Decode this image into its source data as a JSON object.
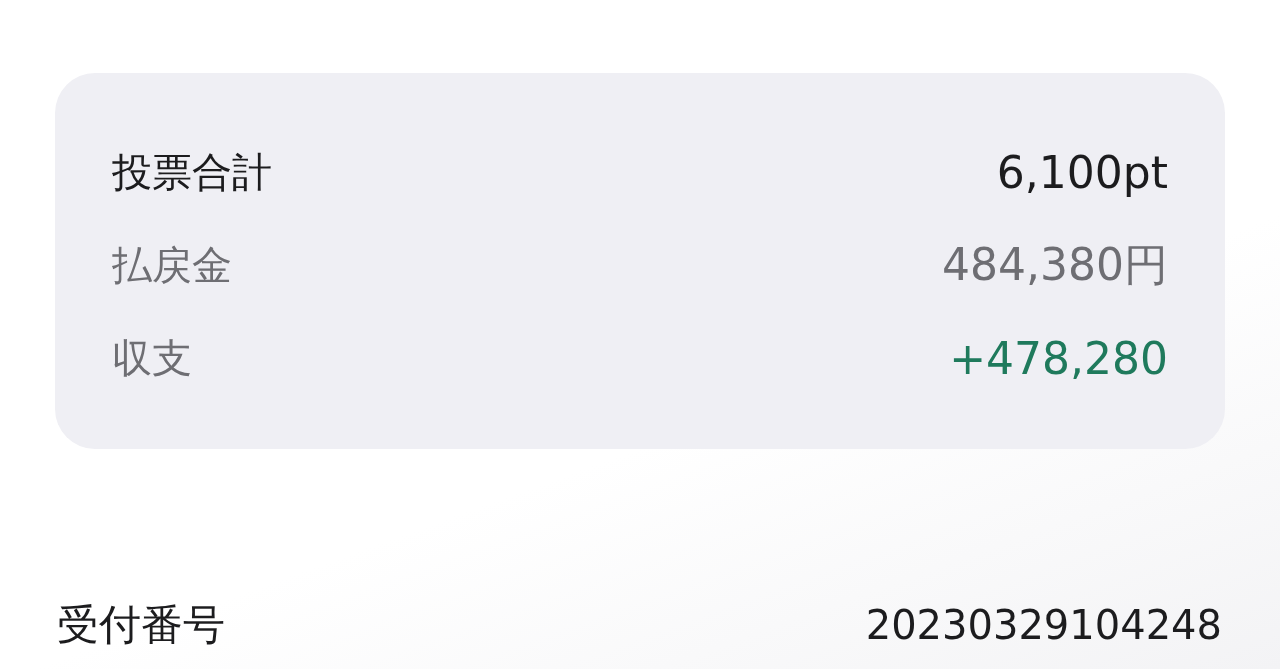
{
  "summary": {
    "rows": [
      {
        "label": "投票合計",
        "value": "6,100pt",
        "kind": "primary"
      },
      {
        "label": "払戻金",
        "value": "484,380円",
        "kind": "secondary"
      },
      {
        "label": "収支",
        "value": "+478,280",
        "kind": "positive"
      }
    ]
  },
  "receipt": {
    "label": "受付番号",
    "value": "20230329104248"
  }
}
